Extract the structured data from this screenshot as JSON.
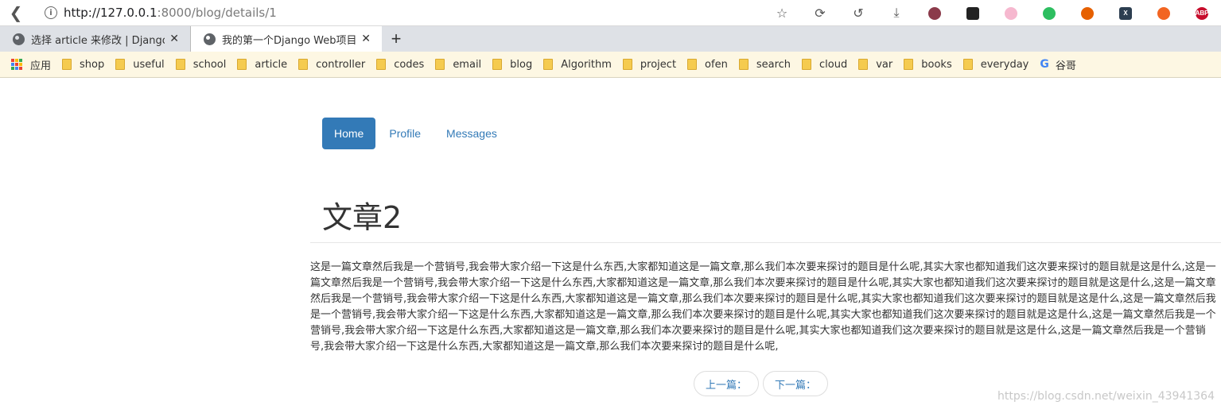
{
  "browser": {
    "url_host": "http://127.0.0.1",
    "url_rest": ":8000/blog/details/1",
    "tabs": [
      {
        "title": "选择 article 来修改 | Django 站",
        "active": false
      },
      {
        "title": "我的第一个Django Web项目",
        "active": true
      }
    ],
    "toolbar_icons": [
      "star-icon",
      "sync-icon",
      "history-icon",
      "download-icon",
      "avatar-icon",
      "extension-icon",
      "cat-icon",
      "evernote-icon",
      "firefox-icon",
      "x-icon",
      "network-icon",
      "abp-icon"
    ],
    "abp_label": "ABP"
  },
  "bookmarks": {
    "apps_label": "应用",
    "items": [
      "shop",
      "useful",
      "school",
      "article",
      "controller",
      "codes",
      "email",
      "blog",
      "Algorithm",
      "project",
      "ofen",
      "search",
      "cloud",
      "var",
      "books",
      "everyday"
    ],
    "google_label": "谷哥"
  },
  "page": {
    "nav": [
      {
        "label": "Home",
        "active": true
      },
      {
        "label": "Profile",
        "active": false
      },
      {
        "label": "Messages",
        "active": false
      }
    ],
    "title": "文章2",
    "content": "这是一篇文章然后我是一个营销号,我会带大家介绍一下这是什么东西,大家都知道这是一篇文章,那么我们本次要来探讨的题目是什么呢,其实大家也都知道我们这次要来探讨的题目就是这是什么,这是一篇文章然后我是一个营销号,我会带大家介绍一下这是什么东西,大家都知道这是一篇文章,那么我们本次要来探讨的题目是什么呢,其实大家也都知道我们这次要来探讨的题目就是这是什么,这是一篇文章然后我是一个营销号,我会带大家介绍一下这是什么东西,大家都知道这是一篇文章,那么我们本次要来探讨的题目是什么呢,其实大家也都知道我们这次要来探讨的题目就是这是什么,这是一篇文章然后我是一个营销号,我会带大家介绍一下这是什么东西,大家都知道这是一篇文章,那么我们本次要来探讨的题目是什么呢,其实大家也都知道我们这次要来探讨的题目就是这是什么,这是一篇文章然后我是一个营销号,我会带大家介绍一下这是什么东西,大家都知道这是一篇文章,那么我们本次要来探讨的题目是什么呢,其实大家也都知道我们这次要来探讨的题目就是这是什么,这是一篇文章然后我是一个营销号,我会带大家介绍一下这是什么东西,大家都知道这是一篇文章,那么我们本次要来探讨的题目是什么呢,",
    "prev_label": "上一篇：",
    "next_label": "下一篇：",
    "watermark": "https://blog.csdn.net/weixin_43941364"
  },
  "colors": {
    "primary": "#337ab7",
    "bookmark_bar": "#fdf7e3",
    "tab_strip": "#dee1e6"
  }
}
